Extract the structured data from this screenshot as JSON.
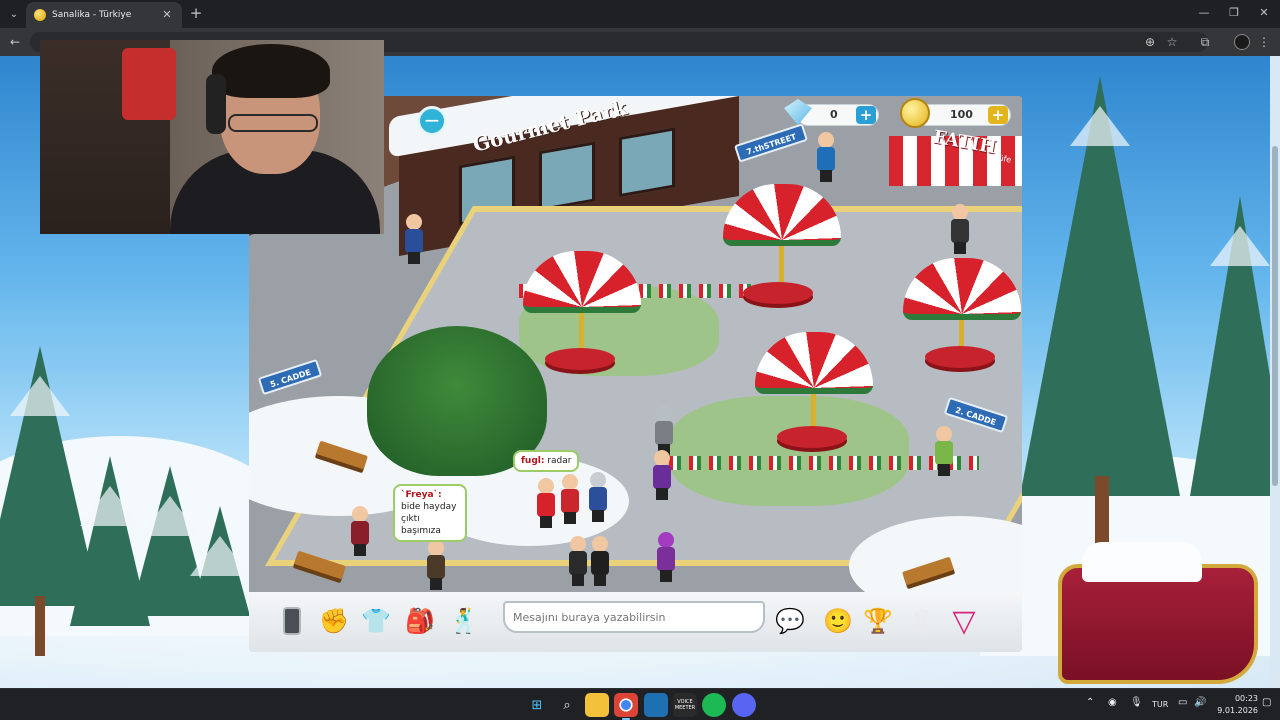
{
  "browser": {
    "tab_title": "Sanalika - Türkiye",
    "tab_close": "✕",
    "new_tab": "+",
    "window_controls": {
      "minimize": "—",
      "restore": "❐",
      "close": "✕"
    },
    "toolbar_icons": [
      "back-icon",
      "zoom-icon",
      "star-icon",
      "extensions-icon",
      "menu-icon"
    ]
  },
  "game": {
    "zoom_out": "−",
    "diamonds": "0",
    "coins": "100",
    "plus": "+",
    "shop_sign": "Gourmet Park",
    "fatih_sign": "FATIH",
    "fatih_sub": "Büfe",
    "street_signs": [
      "7.thSTREET",
      "5. CADDE",
      "2. CADDE"
    ],
    "chat_bubbles": [
      {
        "user": "fugl:",
        "text": "radar"
      },
      {
        "user": "`Freya`:",
        "text": "bide hayday çıktı başımıza"
      }
    ],
    "chat_placeholder": "Mesajını buraya yazabilirsin",
    "colors": {
      "coin_plus": "#e3b51c",
      "diamond_plus": "#2a9fd6",
      "accent_red": "#d7222b"
    }
  },
  "taskbar": {
    "language": "TUR",
    "time": "00:23",
    "date": "9.01.2026",
    "apps": [
      "start-icon",
      "search-icon",
      "file-explorer-icon",
      "chrome-icon",
      "photos-icon",
      "voicemeeter-icon",
      "spotify-icon",
      "discord-icon"
    ],
    "voicemeeter_label": "VOICE MEETER"
  }
}
